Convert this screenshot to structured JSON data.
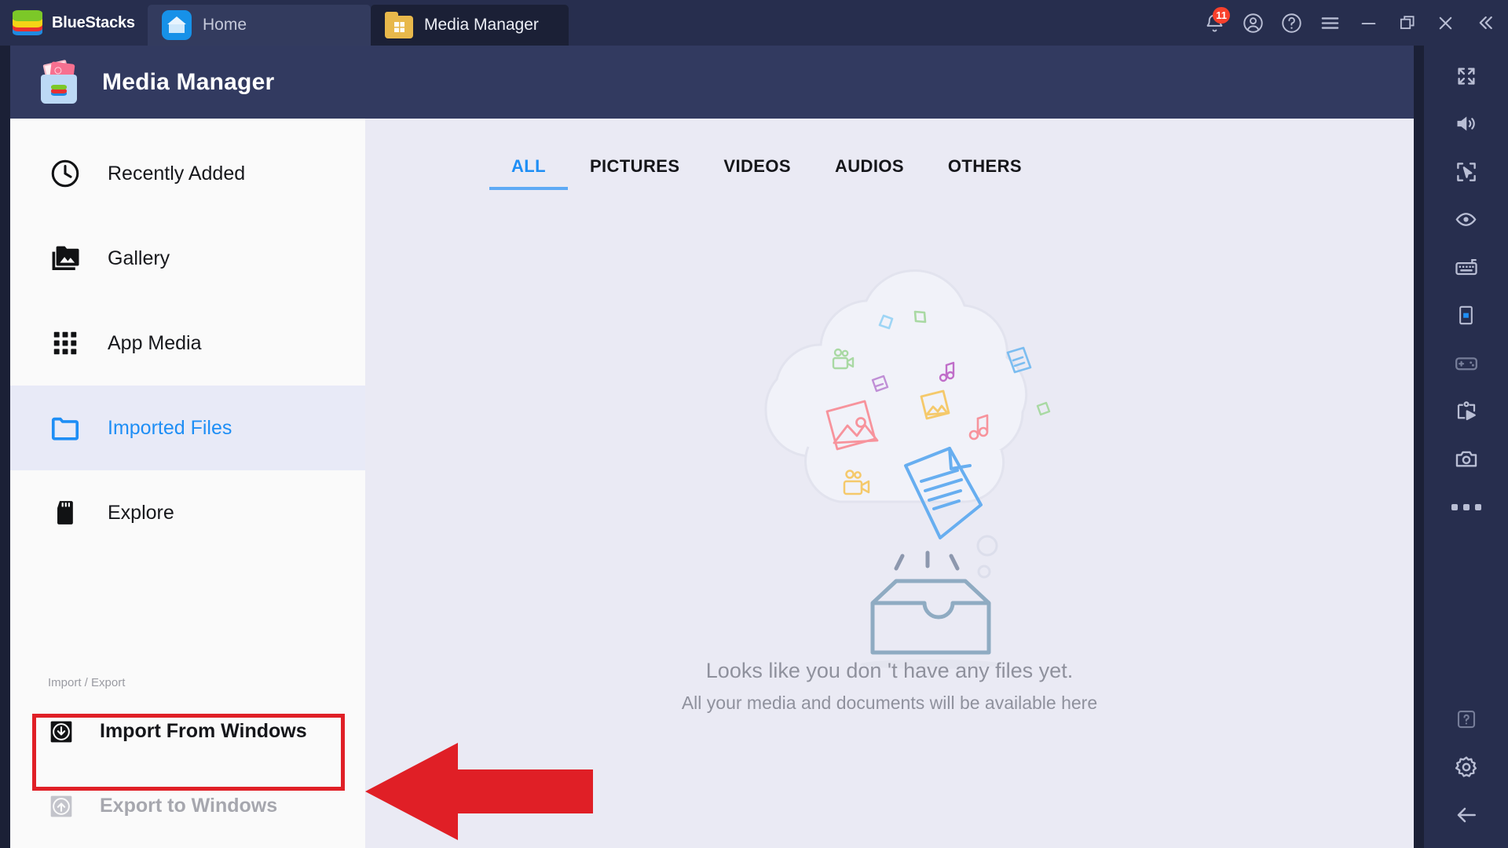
{
  "titlebar": {
    "brand": "BlueStacks",
    "tabs": [
      {
        "label": "Home",
        "icon": "home-icon",
        "active": false
      },
      {
        "label": "Media Manager",
        "icon": "media-folder-icon",
        "active": true
      }
    ],
    "controls": {
      "notifications": {
        "name": "notifications-bell-icon",
        "badge": "11"
      },
      "account": "account-icon",
      "help": "help-icon",
      "menu": "hamburger-menu-icon",
      "minimize": "minimize-icon",
      "maximize": "restore-icon",
      "close": "close-icon",
      "collapse": "collapse-chevrons-icon"
    }
  },
  "app_header": {
    "title": "Media Manager",
    "icon": "media-manager-icon"
  },
  "sidebar": {
    "items": [
      {
        "label": "Recently Added",
        "icon": "clock-icon",
        "selected": false
      },
      {
        "label": "Gallery",
        "icon": "photo-library-icon",
        "selected": false
      },
      {
        "label": "App Media",
        "icon": "grid-apps-icon",
        "selected": false
      },
      {
        "label": "Imported Files",
        "icon": "folder-icon",
        "selected": true
      },
      {
        "label": "Explore",
        "icon": "sd-card-icon",
        "selected": false
      }
    ],
    "import_export": {
      "section_title": "Import / Export",
      "items": [
        {
          "label": "Import From Windows",
          "icon": "import-down-icon",
          "disabled": false,
          "highlighted": true
        },
        {
          "label": "Export to Windows",
          "icon": "export-up-icon",
          "disabled": true,
          "highlighted": false
        }
      ]
    }
  },
  "content": {
    "tabs": [
      {
        "label": "ALL",
        "active": true
      },
      {
        "label": "PICTURES",
        "active": false
      },
      {
        "label": "VIDEOS",
        "active": false
      },
      {
        "label": "AUDIOS",
        "active": false
      },
      {
        "label": "OTHERS",
        "active": false
      }
    ],
    "empty_state": {
      "illustration": "cloud-with-files-over-tray-illustration",
      "line1": "Looks like you don 't have any files yet.",
      "line2": "All your media and documents will be available here"
    }
  },
  "right_toolbar": {
    "items": [
      "fullscreen-icon",
      "volume-icon",
      "cursor-frame-icon",
      "eye-eco-mode-icon",
      "keyboard-icon",
      "device-phone-icon",
      "gamepad-icon",
      "macro-play-icon",
      "camera-screenshot-icon",
      "more-dots-icon",
      "question-help-icon",
      "settings-gear-icon",
      "back-arrow-icon"
    ]
  },
  "annotation": {
    "arrow": "red-left-arrow-annotation",
    "box": "red-highlight-box-annotation",
    "color": "#e01f26"
  },
  "colors": {
    "titlebar_bg": "#272e4e",
    "tab_active_bg": "#1b2036",
    "app_header_bg": "#323a60",
    "sidebar_bg": "#fafafa",
    "content_bg": "#eaeaf4",
    "accent_blue": "#1e8ef5",
    "selected_row_bg": "#e8eaf7",
    "badge_red": "#f8402c"
  }
}
